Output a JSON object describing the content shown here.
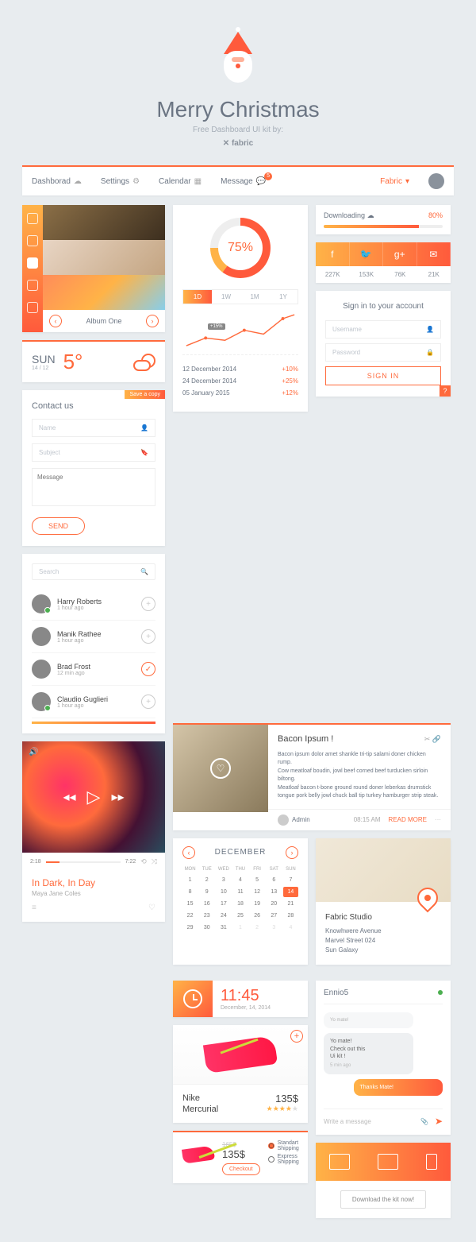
{
  "hero": {
    "title": "Merry Christmas",
    "subtitle": "Free Dashboard UI kit by:",
    "brand": "✕ fabric"
  },
  "nav": {
    "items": [
      {
        "label": "Dashborad"
      },
      {
        "label": "Settings"
      },
      {
        "label": "Calendar"
      },
      {
        "label": "Message",
        "badge": "5"
      }
    ],
    "active": "Fabric"
  },
  "gallery": {
    "title": "Album One"
  },
  "weather": {
    "day": "SUN",
    "date": "14 / 12",
    "temp": "5°"
  },
  "progress": {
    "pct": "75%",
    "tabs": [
      "1D",
      "1W",
      "1M",
      "1Y"
    ],
    "tooltip": "+15%",
    "rows": [
      {
        "date": "12 December 2014",
        "val": "+10%"
      },
      {
        "date": "24 December 2014",
        "val": "+25%"
      },
      {
        "date": "05 January 2015",
        "val": "+12%"
      }
    ]
  },
  "download": {
    "label": "Downloading",
    "pct": "80%"
  },
  "social": {
    "icons": [
      "f",
      "🐦",
      "g+",
      "✉"
    ],
    "counts": [
      "227K",
      "153K",
      "76K",
      "21K"
    ]
  },
  "signin": {
    "title": "Sign in to your account",
    "user_ph": "Username",
    "pass_ph": "Password",
    "btn": "SIGN IN",
    "help": "?"
  },
  "contact": {
    "tag": "Save a copy",
    "title": "Contact us",
    "name_ph": "Name",
    "subject_ph": "Subject",
    "msg_ph": "Message",
    "btn": "SEND"
  },
  "blog": {
    "title": "Bacon Ipsum !",
    "body1": "Bacon ipsum dolor amet shankle tri-tip salami doner chicken rump.",
    "body2": "Cow meatloaf boudin, jowl beef corned beef turducken sirloin biltong.",
    "body3": "Meatloaf bacon t-bone ground round doner leberkas drumstick tongue pork belly jowl chuck ball tip turkey hamburger strip steak.",
    "author": "Admin",
    "time": "08:15 AM",
    "more": "READ MORE"
  },
  "search": {
    "ph": "Search",
    "people": [
      {
        "name": "Harry Roberts",
        "ago": "1 hour ago",
        "online": true,
        "action": "+"
      },
      {
        "name": "Manik Rathee",
        "ago": "1 hour ago",
        "online": false,
        "action": "+"
      },
      {
        "name": "Brad Frost",
        "ago": "12 min ago",
        "online": false,
        "action": "✓"
      },
      {
        "name": "Claudio Guglieri",
        "ago": "1 hour ago",
        "online": true,
        "action": "+"
      }
    ]
  },
  "calendar": {
    "month": "DECEMBER",
    "headers": [
      "MON",
      "TUE",
      "WED",
      "THU",
      "FRI",
      "SAT",
      "SUN"
    ],
    "selected": 14
  },
  "clock": {
    "time": "11:45",
    "date": "December, 14, 2014"
  },
  "map": {
    "title": "Fabric Studio",
    "line1": "Knowhwere Avenue",
    "line2": "Marvel Street 024",
    "line3": "Sun Galaxy"
  },
  "product": {
    "name1": "Nike",
    "name2": "Mercurial",
    "price": "135$",
    "rating": 4
  },
  "cart": {
    "old": "165$",
    "new": "135$",
    "checkout": "Checkout",
    "ship": [
      {
        "label": "Standart Shipping",
        "sel": true
      },
      {
        "label": "Express Shipping",
        "sel": false
      }
    ]
  },
  "chat": {
    "user": "Ennio5",
    "greeting_top": "Yo mate!",
    "msgs": [
      {
        "text": "Yo mate!\nCheck out this\nUi kit !",
        "in": true,
        "time": "5 min ago"
      },
      {
        "text": "Thanks Mate!",
        "in": false
      }
    ],
    "ph": "Write a message"
  },
  "player": {
    "cur": "2:18",
    "total": "7:22",
    "title": "In Dark, In Day",
    "artist": "Maya Jane Coles"
  },
  "dlkit": {
    "btn": "Download the kit now!"
  }
}
